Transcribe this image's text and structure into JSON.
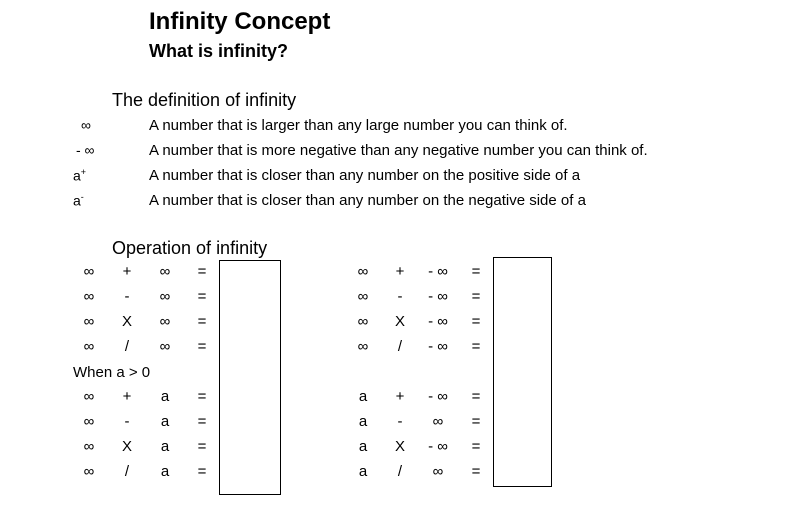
{
  "title": "Infinity Concept",
  "subtitle": "What is infinity?",
  "definition": {
    "heading": "The definition of infinity",
    "items": [
      {
        "symbol": "∞",
        "text": "A number that is larger than any large number you can think of."
      },
      {
        "symbol": "- ∞",
        "text": "A number that is more negative than any negative number you can think of."
      },
      {
        "symbol": "a",
        "sup": "+",
        "text": "A number that is closer than any number on the positive side of a"
      },
      {
        "symbol": "a",
        "sup": "-",
        "text": "A number that is closer than any number on the negative side of a"
      }
    ]
  },
  "operations": {
    "heading": "Operation of infinity",
    "condition": "When a > 0",
    "left_rows": [
      [
        "∞",
        "+",
        "∞",
        "="
      ],
      [
        "∞",
        "-",
        "∞",
        "="
      ],
      [
        "∞",
        "X",
        "∞",
        "="
      ],
      [
        "∞",
        "/",
        "∞",
        "="
      ],
      [
        "∞",
        "+",
        "a",
        "="
      ],
      [
        "∞",
        "-",
        "a",
        "="
      ],
      [
        "∞",
        "X",
        "a",
        "="
      ],
      [
        "∞",
        "/",
        "a",
        "="
      ]
    ],
    "right_rows": [
      [
        "∞",
        "+",
        "- ∞",
        "="
      ],
      [
        "∞",
        "-",
        "- ∞",
        "="
      ],
      [
        "∞",
        "X",
        "- ∞",
        "="
      ],
      [
        "∞",
        "/",
        "- ∞",
        "="
      ],
      [
        "a",
        "+",
        "- ∞",
        "="
      ],
      [
        "a",
        "-",
        "∞",
        "="
      ],
      [
        "a",
        "X",
        "- ∞",
        "="
      ],
      [
        "a",
        "/",
        "∞",
        "="
      ]
    ]
  }
}
